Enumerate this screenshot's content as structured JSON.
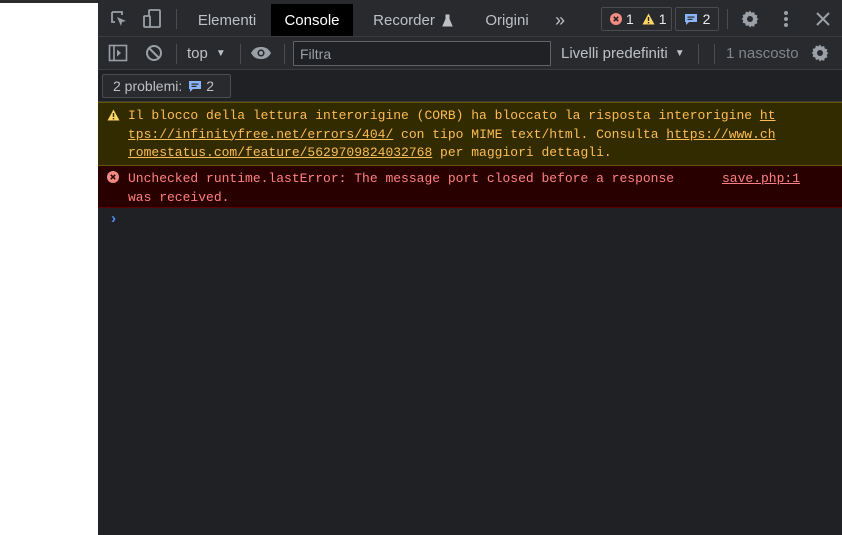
{
  "tabs": [
    {
      "label": "Elementi"
    },
    {
      "label": "Console",
      "active": true
    },
    {
      "label": "Recorder"
    },
    {
      "label": "Origini"
    }
  ],
  "more_tabs": "»",
  "counters": {
    "errors": "1",
    "warnings": "1",
    "issues": "2"
  },
  "toolbar": {
    "context": "top",
    "filter_placeholder": "Filtra",
    "levels": "Livelli predefiniti",
    "hidden": "1 nascosto"
  },
  "issues_bar": {
    "label": "2 problemi:",
    "count": "2"
  },
  "messages": {
    "warning": {
      "line1_text": "Il blocco della lettura interorigine (CORB) ha bloccato la risposta interorigine ",
      "line1_link": "ht",
      "line2_link": "tps://infinityfree.net/errors/404/",
      "line2_text": " con tipo MIME text/html. Consulta ",
      "line2_link2": "https://www.ch",
      "line3_link": "romestatus.com/feature/5629709824032768",
      "line3_text": " per maggiori dettagli."
    },
    "error": {
      "line1": "Unchecked runtime.lastError: The message port closed before a response",
      "line2": "was received.",
      "source": "save.php:1"
    }
  },
  "prompt": "›",
  "colors": {
    "accent_blue": "#4e8ef7",
    "error_red": "#f28b82",
    "warning_yellow": "#fdd663",
    "issue_blue": "#1a73e8"
  }
}
